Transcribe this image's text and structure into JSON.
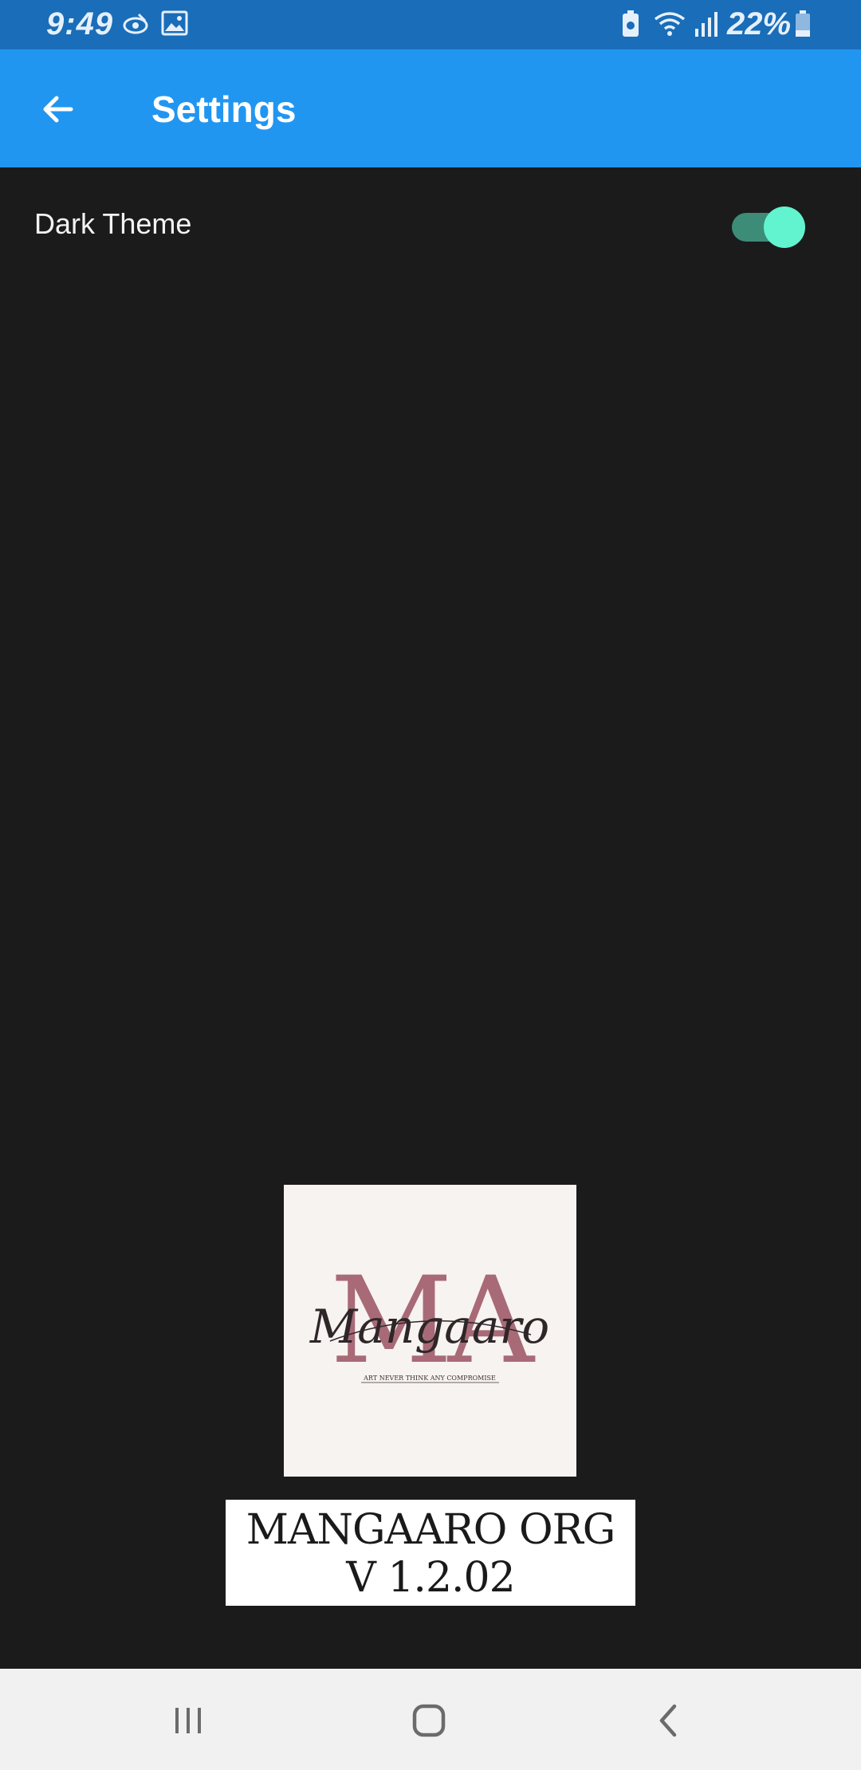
{
  "status_bar": {
    "time": "9:49",
    "battery": "22%",
    "icons": [
      "app-notification-icon",
      "image-icon",
      "battery-saver-icon",
      "wifi-icon",
      "signal-icon",
      "battery-icon"
    ]
  },
  "app_bar": {
    "title": "Settings",
    "back_icon": "arrow-back-icon",
    "color": "#2196f0"
  },
  "settings": {
    "dark_theme": {
      "label": "Dark Theme",
      "enabled": true,
      "accent": "#62f4cf"
    }
  },
  "logo": {
    "monogram": "MA",
    "script": "Mangaaro",
    "tagline": "ART NEVER THINK ANY COMPROMISE"
  },
  "version": {
    "line1": "MANGAARO ORG",
    "line2": "V 1.2.02"
  },
  "nav_bar": {
    "icons": [
      "recent-apps-icon",
      "home-icon",
      "back-icon"
    ]
  }
}
